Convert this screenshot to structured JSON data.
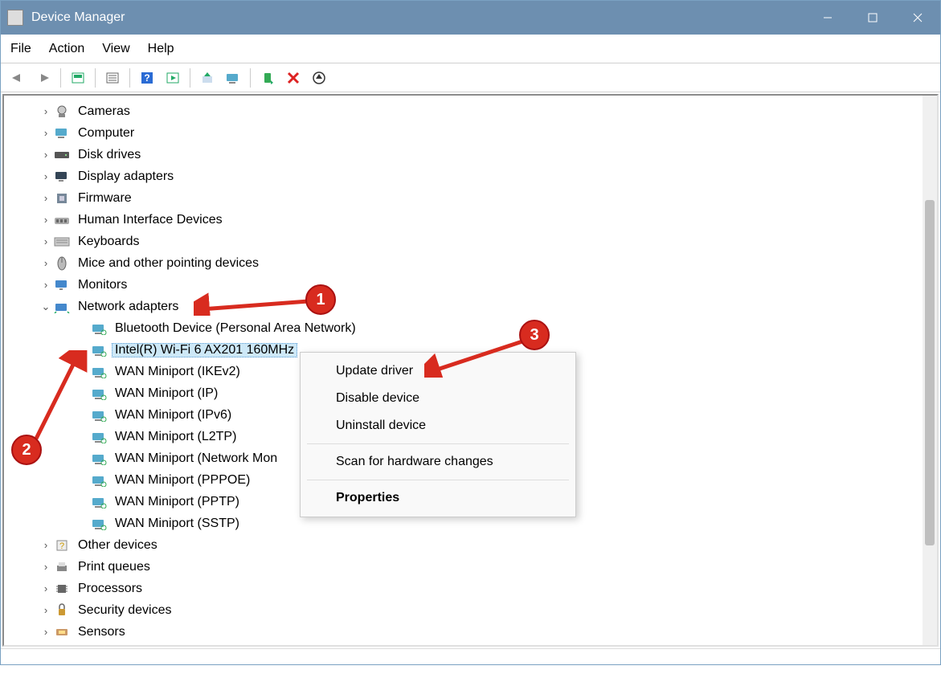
{
  "window": {
    "title": "Device Manager"
  },
  "menubar": {
    "items": [
      "File",
      "Action",
      "View",
      "Help"
    ]
  },
  "tree": {
    "categories": [
      {
        "label": "Cameras",
        "icon": "camera",
        "chev": "›"
      },
      {
        "label": "Computer",
        "icon": "computer",
        "chev": "›"
      },
      {
        "label": "Disk drives",
        "icon": "disk",
        "chev": "›"
      },
      {
        "label": "Display adapters",
        "icon": "display",
        "chev": "›"
      },
      {
        "label": "Firmware",
        "icon": "firmware",
        "chev": "›"
      },
      {
        "label": "Human Interface Devices",
        "icon": "hid",
        "chev": "›"
      },
      {
        "label": "Keyboards",
        "icon": "keyboard",
        "chev": "›"
      },
      {
        "label": "Mice and other pointing devices",
        "icon": "mouse",
        "chev": "›"
      },
      {
        "label": "Monitors",
        "icon": "monitor",
        "chev": "›"
      },
      {
        "label": "Network adapters",
        "icon": "network",
        "chev": "⌄",
        "expanded": true,
        "children": [
          {
            "label": "Bluetooth Device (Personal Area Network)",
            "icon": "netcard"
          },
          {
            "label": "Intel(R) Wi-Fi 6 AX201 160MHz",
            "icon": "netcard",
            "selected": true
          },
          {
            "label": "WAN Miniport (IKEv2)",
            "icon": "netcard"
          },
          {
            "label": "WAN Miniport (IP)",
            "icon": "netcard"
          },
          {
            "label": "WAN Miniport (IPv6)",
            "icon": "netcard"
          },
          {
            "label": "WAN Miniport (L2TP)",
            "icon": "netcard"
          },
          {
            "label": "WAN Miniport (Network Mon",
            "icon": "netcard"
          },
          {
            "label": "WAN Miniport (PPPOE)",
            "icon": "netcard"
          },
          {
            "label": "WAN Miniport (PPTP)",
            "icon": "netcard"
          },
          {
            "label": "WAN Miniport (SSTP)",
            "icon": "netcard"
          }
        ]
      },
      {
        "label": "Other devices",
        "icon": "other",
        "chev": "›"
      },
      {
        "label": "Print queues",
        "icon": "printer",
        "chev": "›"
      },
      {
        "label": "Processors",
        "icon": "processor",
        "chev": "›"
      },
      {
        "label": "Security devices",
        "icon": "security",
        "chev": "›"
      },
      {
        "label": "Sensors",
        "icon": "sensor",
        "chev": "›"
      }
    ]
  },
  "context_menu": {
    "items": [
      {
        "label": "Update driver",
        "type": "item"
      },
      {
        "label": "Disable device",
        "type": "item"
      },
      {
        "label": "Uninstall device",
        "type": "item"
      },
      {
        "type": "sep"
      },
      {
        "label": "Scan for hardware changes",
        "type": "item"
      },
      {
        "type": "sep"
      },
      {
        "label": "Properties",
        "type": "item",
        "bold": true
      }
    ]
  },
  "annotations": {
    "1": "1",
    "2": "2",
    "3": "3"
  }
}
